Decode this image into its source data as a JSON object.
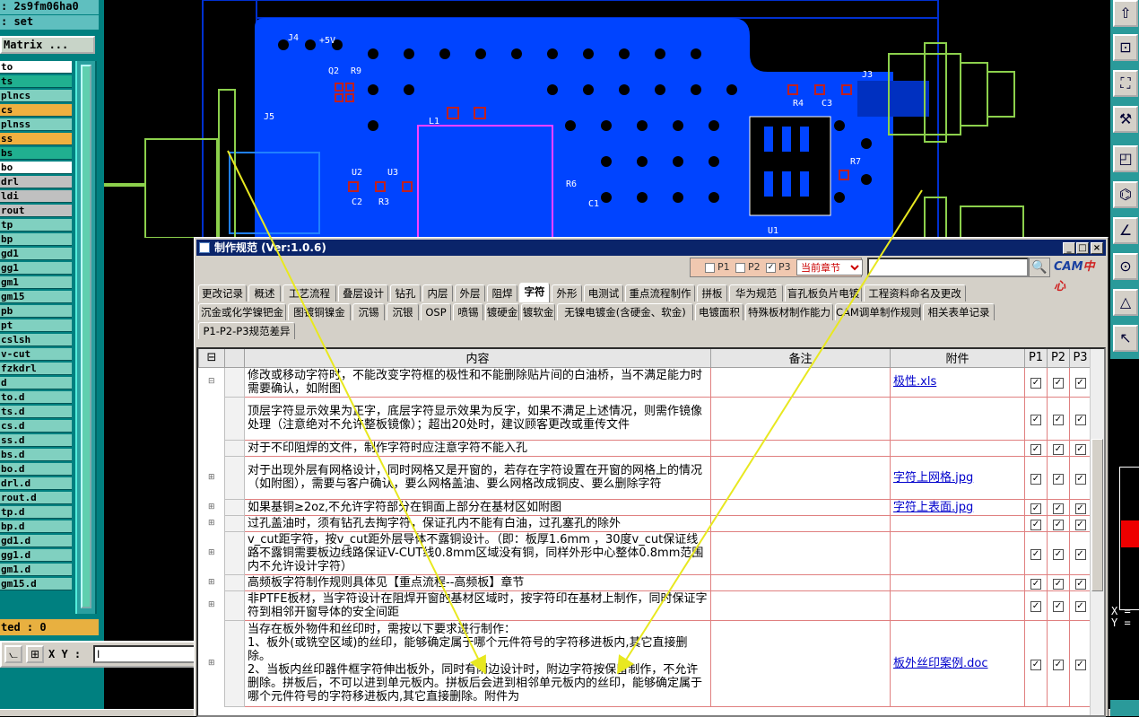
{
  "left_panel": {
    "title": ": 2s9fm06ha0",
    "cmd": ": set",
    "matrix_button": "Matrix ...",
    "layers": [
      {
        "name": "to",
        "color": "#ffffff"
      },
      {
        "name": "ts",
        "color": "#20b090"
      },
      {
        "name": "plncs",
        "color": "#80d0c0"
      },
      {
        "name": "cs",
        "color": "#f0b040"
      },
      {
        "name": "plnss",
        "color": "#80d0c0"
      },
      {
        "name": "ss",
        "color": "#f0b040"
      },
      {
        "name": "bs",
        "color": "#20b090"
      },
      {
        "name": "bo",
        "color": "#ffffff"
      },
      {
        "name": "drl",
        "color": "#c0c0c0"
      },
      {
        "name": "ldi",
        "color": "#c0c0c0"
      },
      {
        "name": "rout",
        "color": "#c0c0c0"
      },
      {
        "name": "tp",
        "color": "#80d0c0"
      },
      {
        "name": "bp",
        "color": "#80d0c0"
      },
      {
        "name": "gd1",
        "color": "#80d0c0"
      },
      {
        "name": "gg1",
        "color": "#80d0c0"
      },
      {
        "name": "gm1",
        "color": "#80d0c0"
      },
      {
        "name": "gm15",
        "color": "#80d0c0"
      },
      {
        "name": "pb",
        "color": "#80d0c0"
      },
      {
        "name": "pt",
        "color": "#80d0c0"
      },
      {
        "name": "cslsh",
        "color": "#80d0c0"
      },
      {
        "name": "v-cut",
        "color": "#80d0c0"
      },
      {
        "name": "fzkdrl",
        "color": "#80d0c0"
      },
      {
        "name": "d",
        "color": "#80d0c0"
      },
      {
        "name": "to.d",
        "color": "#80d0c0"
      },
      {
        "name": "ts.d",
        "color": "#80d0c0"
      },
      {
        "name": "cs.d",
        "color": "#80d0c0"
      },
      {
        "name": "ss.d",
        "color": "#80d0c0"
      },
      {
        "name": "bs.d",
        "color": "#80d0c0"
      },
      {
        "name": "bo.d",
        "color": "#80d0c0"
      },
      {
        "name": "drl.d",
        "color": "#80d0c0"
      },
      {
        "name": "rout.d",
        "color": "#80d0c0"
      },
      {
        "name": "tp.d",
        "color": "#80d0c0"
      },
      {
        "name": "bp.d",
        "color": "#80d0c0"
      },
      {
        "name": "gd1.d",
        "color": "#80d0c0"
      },
      {
        "name": "gg1.d",
        "color": "#80d0c0"
      },
      {
        "name": "gm1.d",
        "color": "#80d0c0"
      },
      {
        "name": "gm15.d",
        "color": "#80d0c0"
      }
    ],
    "selected_label": "ted : 0",
    "xy_label": "X Y :",
    "xy_value": "I"
  },
  "right_mini": {
    "x": "X =",
    "y": "Y ="
  },
  "pcb_labels": [
    "J4",
    "+5V",
    "Q2",
    "R9",
    "J5",
    "L1",
    "U2",
    "U3",
    "C2",
    "R3",
    "R6",
    "C1",
    "J3",
    "R4",
    "C3",
    "R7",
    "U1"
  ],
  "dialog": {
    "title": "制作规范 (Ver:1.0.6)",
    "filters": [
      {
        "label": "P1",
        "checked": false
      },
      {
        "label": "P2",
        "checked": false
      },
      {
        "label": "P3",
        "checked": true
      }
    ],
    "scope_select": "当前章节",
    "search_value": "",
    "logo_a": "CAM",
    "logo_b": "中心",
    "tabs_row1": [
      "更改记录",
      "概述",
      "工艺流程",
      "叠层设计",
      "钻孔",
      "内层",
      "外层",
      "阻焊",
      "字符",
      "外形",
      "电测试",
      "重点流程制作",
      "拼板",
      "华为规范",
      "盲孔板负片电镀",
      "工程资料命名及更改"
    ],
    "tabs_row2": [
      "沉金或化学镍钯金",
      "图镀铜镍金",
      "沉锡",
      "沉银",
      "OSP",
      "喷锡",
      "镀硬金",
      "镀软金",
      "无镍电镀金(含硬金、软金)",
      "电镀面积",
      "特殊板材制作能力",
      "CAM调单制作规则",
      "相关表单记录"
    ],
    "tabs_row3": [
      "P1-P2-P3规范差异"
    ],
    "active_tab": "字符",
    "columns": [
      "内容",
      "备注",
      "附件",
      "P1",
      "P2",
      "P3"
    ],
    "rows": [
      {
        "expand": "⊟",
        "content": "修改或移动字符时，不能改变字符框的极性和不能删除贴片间的白油桥，当不满足能力时需要确认，如附图",
        "note": "",
        "attachment": "极性.xls",
        "p1": "✓",
        "p2": "✓",
        "p3": "✓"
      },
      {
        "expand": "",
        "content": "顶层字符显示效果为正字，底层字符显示效果为反字，如果不满足上述情况，则需作镜像处理（注意绝对不允许整板镜像）；超出20处时，建议顾客更改或重传文件",
        "note": "",
        "attachment": "",
        "p1": "✓",
        "p2": "✓",
        "p3": "✓"
      },
      {
        "expand": "",
        "content": "对于不印阻焊的文件，制作字符时应注意字符不能入孔",
        "note": "",
        "attachment": "",
        "p1": "✓",
        "p2": "✓",
        "p3": "✓"
      },
      {
        "expand": "⊞",
        "content": "对于出现外层有网格设计，同时网格又是开窗的，若存在字符设置在开窗的网格上的情况（如附图），需要与客户确认，要么网格盖油、要么网格改成铜皮、要么删除字符",
        "note": "",
        "attachment": "字符上网格.jpg",
        "p1": "✓",
        "p2": "✓",
        "p3": "✓"
      },
      {
        "expand": "⊞",
        "content": "如果基铜≥2oz,不允许字符部分在铜面上部分在基材区如附图",
        "note": "",
        "attachment": "字符上表面.jpg",
        "p1": "✓",
        "p2": "✓",
        "p3": "✓"
      },
      {
        "expand": "⊞",
        "content": "过孔盖油时，须有钻孔去掏字符，保证孔内不能有白油，过孔塞孔的除外",
        "note": "",
        "attachment": "",
        "p1": "✓",
        "p2": "✓",
        "p3": "✓"
      },
      {
        "expand": "⊞",
        "content": "v_cut距字符，按v_cut距外层导体不露铜设计。（即：板厚1.6mm ，30度v_cut保证线路不露铜需要板边线路保证V-CUT线0.8mm区域没有铜，同样外形中心整体0.8mm范围内不允许设计字符）",
        "note": "",
        "attachment": "",
        "p1": "✓",
        "p2": "✓",
        "p3": "✓"
      },
      {
        "expand": "⊞",
        "content": "高频板字符制作规则具体见【重点流程--高频板】章节",
        "note": "",
        "attachment": "",
        "p1": "✓",
        "p2": "✓",
        "p3": "✓"
      },
      {
        "expand": "⊞",
        "content": "非PTFE板材，当字符设计在阻焊开窗的基材区域时，按字符印在基材上制作，同时保证字符到相邻开窗导体的安全间距",
        "note": "",
        "attachment": "",
        "p1": "✓",
        "p2": "✓",
        "p3": "✓"
      },
      {
        "expand": "⊞",
        "content": "当存在板外物件和丝印时，需按以下要求进行制作：\n1、板外(或铣空区域)的丝印，能够确定属于哪个元件符号的字符移进板内,其它直接删除。\n2、当板内丝印器件框字符伸出板外，同时有附边设计时，附边字符按保留制作，不允许删除。拼板后，不可以进到单元板内。拼板后会进到相邻单元板内的丝印，能够确定属于哪个元件符号的字符移进板内,其它直接删除。附件为",
        "note": "",
        "attachment": "板外丝印案例.doc",
        "p1": "✓",
        "p2": "✓",
        "p3": "✓"
      }
    ]
  }
}
